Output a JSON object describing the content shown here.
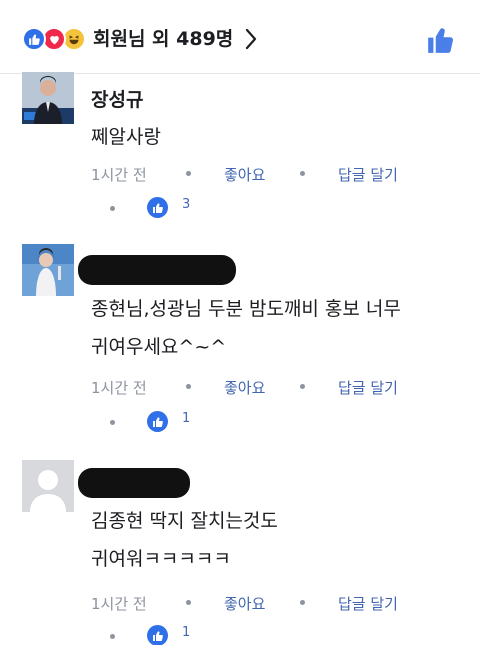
{
  "reactions_bar": {
    "icons": [
      "like-icon",
      "love-icon",
      "haha-icon"
    ],
    "summary": "회원님 외 489명"
  },
  "colors": {
    "like_blue": "#2f6fe8",
    "love_red": "#f0284a",
    "haha_yellow": "#f5c33b",
    "link_blue": "#4267b2",
    "meta_gray": "#8d949e"
  },
  "comments": [
    {
      "author": "장성규",
      "author_redacted": false,
      "lines": [
        "쩨알사랑"
      ],
      "time": "1시간 전",
      "like_label": "좋아요",
      "reply_label": "답글 달기",
      "reaction_count": "3"
    },
    {
      "author": "",
      "author_redacted": true,
      "lines": [
        "종현님,성광님 두분 밤도깨비 홍보 너무",
        "귀여우세요^~^"
      ],
      "time": "1시간 전",
      "like_label": "좋아요",
      "reply_label": "답글 달기",
      "reaction_count": "1"
    },
    {
      "author": "",
      "author_redacted": true,
      "lines": [
        "김종현 딱지 잘치는것도",
        "귀여워ㅋㅋㅋㅋㅋ"
      ],
      "time": "1시간 전",
      "like_label": "좋아요",
      "reply_label": "답글 달기",
      "reaction_count": "1"
    }
  ]
}
